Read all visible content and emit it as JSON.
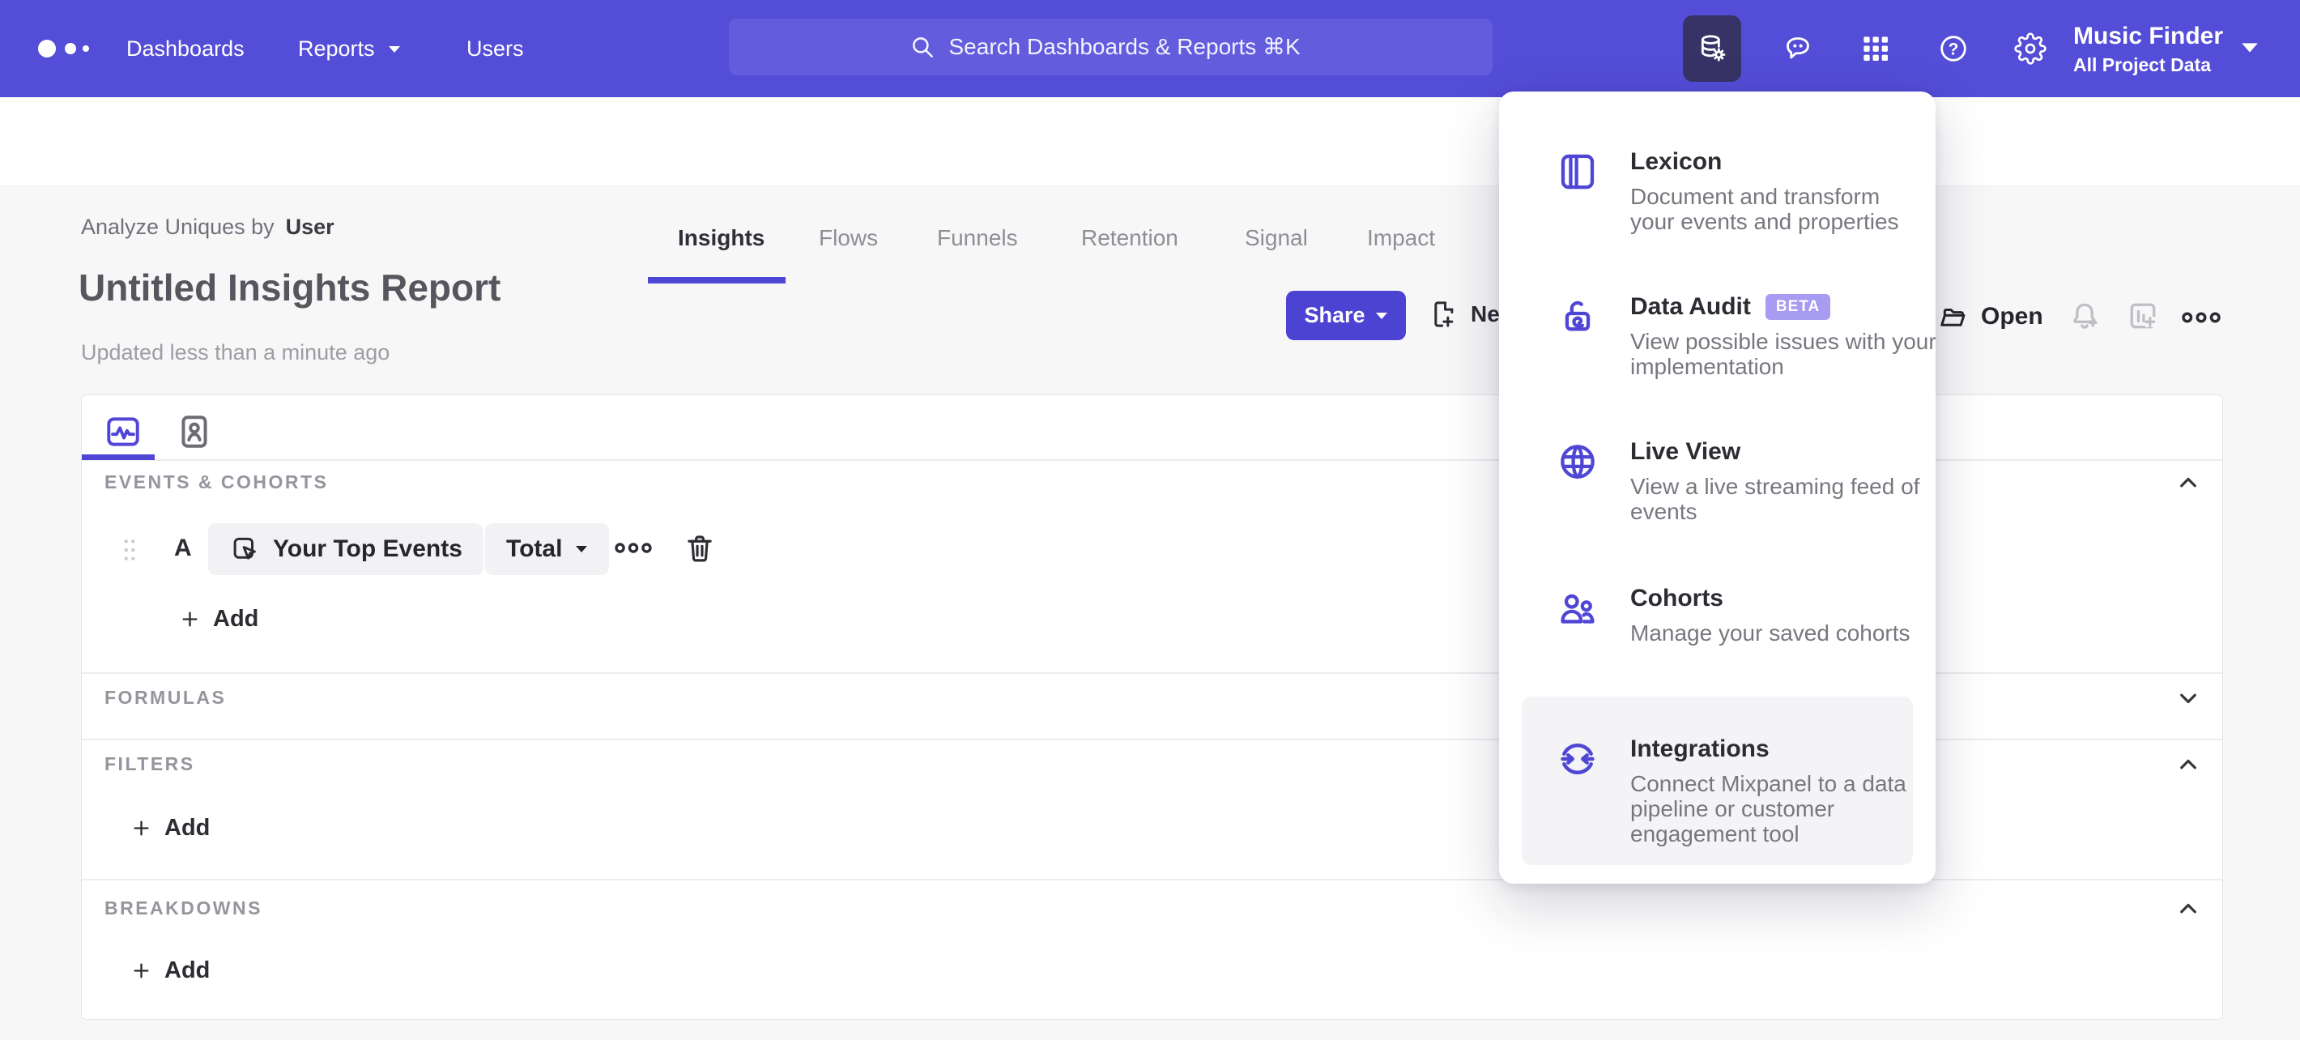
{
  "colors": {
    "header_bg": "#544dd7",
    "search_bg": "#635dde",
    "active_tool_bg": "#373366",
    "accent_purple": "#4f46d6",
    "page_bg": "#f7f7f8",
    "beta_badge_bg": "#a79bf2",
    "chip_bg": "#f2f2f4",
    "menu_highlight_bg": "#f4f4f6"
  },
  "icons": {
    "help_glyph": "?"
  },
  "header": {
    "nav": [
      {
        "label": "Dashboards"
      },
      {
        "label": "Reports"
      },
      {
        "label": "Users"
      }
    ],
    "search": {
      "placeholder": "Search Dashboards & Reports ⌘K"
    },
    "project": {
      "name": "Music Finder",
      "scope": "All Project Data"
    }
  },
  "tabs": {
    "items": [
      {
        "label": "Insights",
        "active": true
      },
      {
        "label": "Flows",
        "active": false
      },
      {
        "label": "Funnels",
        "active": false
      },
      {
        "label": "Retention",
        "active": false
      },
      {
        "label": "Signal",
        "active": false
      },
      {
        "label": "Impact",
        "active": false
      }
    ]
  },
  "report": {
    "analyze_prefix": "Analyze Uniques by",
    "analyze_value": "User",
    "title": "Untitled Insights Report",
    "updated": "Updated less than a minute ago",
    "share_label": "Share",
    "new_label_visible": "Ne",
    "open_label": "Open"
  },
  "builder": {
    "events_section_label": "EVENTS & COHORTS",
    "formulas_section_label": "FORMULAS",
    "filters_section_label": "FILTERS",
    "breakdowns_section_label": "BREAKDOWNS",
    "event_row": {
      "letter": "A",
      "event_name": "Your Top Events",
      "aggregation": "Total"
    },
    "add_label": "Add",
    "sections_state": {
      "events": "expanded",
      "formulas": "collapsed",
      "filters": "expanded",
      "breakdowns": "expanded"
    }
  },
  "menu": {
    "items": [
      {
        "title": "Lexicon",
        "description": "Document and transform your events and properties"
      },
      {
        "title": "Data Audit",
        "badge": "BETA",
        "description": "View possible issues with your implementation"
      },
      {
        "title": "Live View",
        "description": "View a live streaming feed of events"
      },
      {
        "title": "Cohorts",
        "description": "Manage your saved cohorts"
      },
      {
        "title": "Integrations",
        "description": "Connect Mixpanel to a data pipeline or customer engagement tool",
        "highlighted": true
      }
    ]
  }
}
